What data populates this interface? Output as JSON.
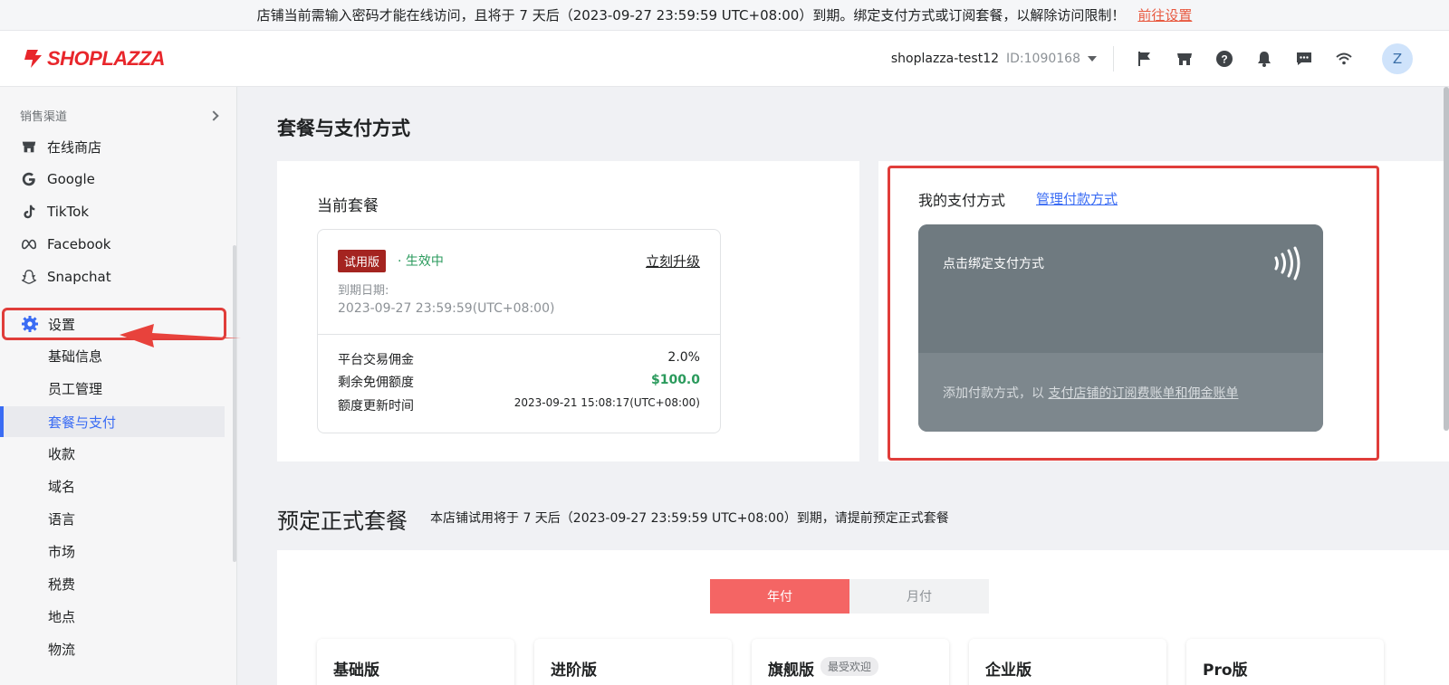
{
  "banner": {
    "message": "店铺当前需输入密码才能在线访问，且将于 7 天后（2023-09-27 23:59:59 UTC+08:00）到期。绑定支付方式或订阅套餐，以解除访问限制！",
    "link": "前往设置"
  },
  "header": {
    "logo_text": "SHOPLAZZA",
    "store_name": "shoplazza-test12",
    "store_id": "ID:1090168",
    "avatar_letter": "Z",
    "icons": [
      "flag-icon",
      "store-icon",
      "help-icon",
      "bell-icon",
      "chat-icon",
      "wifi-icon"
    ]
  },
  "sidebar": {
    "section_title": "销售渠道",
    "channels": [
      {
        "label": "在线商店",
        "icon": "store-icon"
      },
      {
        "label": "Google",
        "icon": "google-icon"
      },
      {
        "label": "TikTok",
        "icon": "tiktok-icon"
      },
      {
        "label": "Facebook",
        "icon": "meta-icon"
      },
      {
        "label": "Snapchat",
        "icon": "snapchat-icon"
      }
    ],
    "settings_label": "设置",
    "sub_items": [
      "基础信息",
      "员工管理",
      "套餐与支付",
      "收款",
      "域名",
      "语言",
      "市场",
      "税费",
      "地点",
      "物流"
    ],
    "active_index": 2
  },
  "main": {
    "page_title": "套餐与支付方式",
    "current_plan": {
      "title": "当前套餐",
      "tag": "试用版",
      "status": "· 生效中",
      "upgrade": "立刻升级",
      "expire_label": "到期日期:",
      "expire_value": "2023-09-27 23:59:59(UTC+08:00)",
      "rows": [
        {
          "label": "平台交易佣金",
          "value": "2.0%"
        },
        {
          "label": "剩余免佣额度",
          "value": "$100.0"
        },
        {
          "label": "额度更新时间",
          "value": "2023-09-21 15:08:17(UTC+08:00)"
        }
      ]
    },
    "payment": {
      "title": "我的支付方式",
      "manage": "管理付款方式",
      "card_text": "点击绑定支付方式",
      "hint_prefix": "添加付款方式，以 ",
      "hint_link": "支付店铺的订阅费账单和佣金账单"
    },
    "reserve": {
      "title": "预定正式套餐",
      "desc": "本店铺试用将于 7 天后（2023-09-27 23:59:59 UTC+08:00）到期，请提前预定正式套餐",
      "toggle_yearly": "年付",
      "toggle_monthly": "月付",
      "tiers": [
        "基础版",
        "进阶版",
        "旗舰版",
        "企业版",
        "Pro版"
      ],
      "popular_badge": "最受欢迎"
    }
  }
}
